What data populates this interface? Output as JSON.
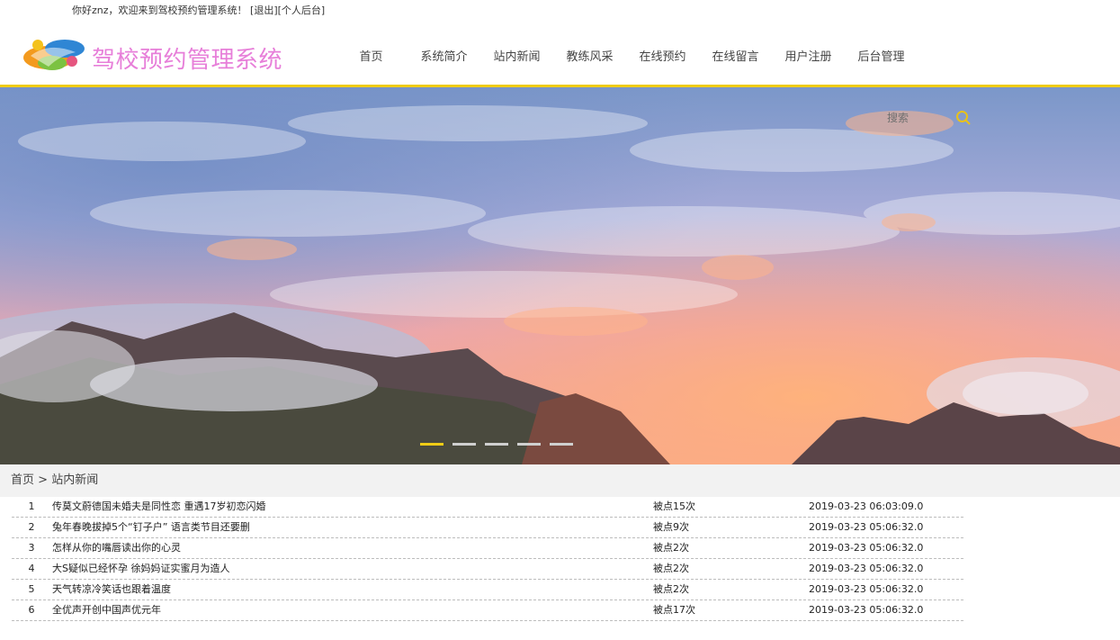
{
  "topbar": {
    "greeting": "你好znz，欢迎来到驾校预约管理系统！",
    "logout": "[退出]",
    "backend": "[个人后台]"
  },
  "logo": {
    "text": "驾校预约管理系统"
  },
  "nav": {
    "items": [
      "首页",
      "系统简介",
      "站内新闻",
      "教练风采",
      "在线预约",
      "在线留言",
      "用户注册",
      "后台管理"
    ]
  },
  "search": {
    "placeholder": "搜索"
  },
  "slider": {
    "count": 5,
    "active": 1
  },
  "breadcrumb": {
    "home": "首页",
    "sep": " > ",
    "current": "站内新闻"
  },
  "news": [
    {
      "no": "1",
      "title": "传莫文蔚德国未婚夫是同性恋 重遇17岁初恋闪婚",
      "hits": "被点15次",
      "date": "2019-03-23 06:03:09.0"
    },
    {
      "no": "2",
      "title": "兔年春晚拔掉5个“钉子户” 语言类节目还要删",
      "hits": "被点9次",
      "date": "2019-03-23 05:06:32.0"
    },
    {
      "no": "3",
      "title": "怎样从你的嘴唇读出你的心灵",
      "hits": "被点2次",
      "date": "2019-03-23 05:06:32.0"
    },
    {
      "no": "4",
      "title": "大S疑似已经怀孕 徐妈妈证实蜜月为造人",
      "hits": "被点2次",
      "date": "2019-03-23 05:06:32.0"
    },
    {
      "no": "5",
      "title": "天气转凉冷笑话也跟着温度",
      "hits": "被点2次",
      "date": "2019-03-23 05:06:32.0"
    },
    {
      "no": "6",
      "title": "全优声开创中国声优元年",
      "hits": "被点17次",
      "date": "2019-03-23 05:06:32.0"
    }
  ]
}
